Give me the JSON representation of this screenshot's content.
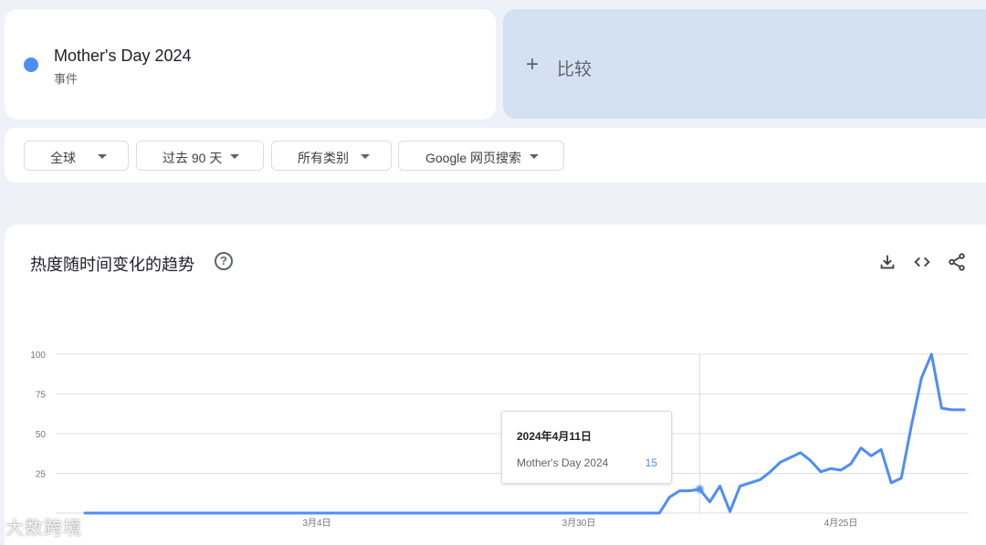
{
  "term": {
    "name": "Mother's Day 2024",
    "type": "事件",
    "color": "#4e8df5"
  },
  "compare": {
    "icon": "plus-icon",
    "plus": "+",
    "label": "比较"
  },
  "filters": [
    {
      "label": "全球"
    },
    {
      "label": "过去 90 天"
    },
    {
      "label": "所有类别"
    },
    {
      "label": "Google 网页搜索"
    }
  ],
  "chart_section": {
    "title": "热度随时间变化的趋势",
    "help": "?",
    "icons": [
      "download-icon",
      "embed-code-icon",
      "share-icon"
    ]
  },
  "tooltip": {
    "date": "2024年4月11日",
    "term": "Mother's Day 2024",
    "value": "15"
  },
  "watermark": "大数跨境",
  "chart_data": {
    "type": "line",
    "title": "",
    "xlabel": "",
    "ylabel": "",
    "ylim": [
      0,
      100
    ],
    "yticks": [
      25,
      50,
      75,
      100
    ],
    "grid": true,
    "xticks": [
      {
        "label": "3月4日",
        "date": "2024-03-04"
      },
      {
        "label": "3月30日",
        "date": "2024-03-30"
      },
      {
        "label": "4月25日",
        "date": "2024-04-25"
      }
    ],
    "highlight": {
      "date": "2024-04-11",
      "value": 15
    },
    "series": [
      {
        "name": "Mother's Day 2024",
        "color": "#4e8df5",
        "x": [
          "2024-02-10",
          "2024-02-15",
          "2024-02-20",
          "2024-02-25",
          "2024-03-01",
          "2024-03-06",
          "2024-03-11",
          "2024-03-16",
          "2024-03-21",
          "2024-03-26",
          "2024-03-31",
          "2024-04-05",
          "2024-04-07",
          "2024-04-08",
          "2024-04-09",
          "2024-04-10",
          "2024-04-11",
          "2024-04-12",
          "2024-04-13",
          "2024-04-14",
          "2024-04-15",
          "2024-04-16",
          "2024-04-17",
          "2024-04-18",
          "2024-04-19",
          "2024-04-20",
          "2024-04-21",
          "2024-04-22",
          "2024-04-23",
          "2024-04-24",
          "2024-04-25",
          "2024-04-26",
          "2024-04-27",
          "2024-04-28",
          "2024-04-29",
          "2024-04-30",
          "2024-05-01",
          "2024-05-02",
          "2024-05-03",
          "2024-05-04",
          "2024-05-05",
          "2024-05-06",
          "2024-05-07",
          "2024-05-08",
          "2024-05-09",
          "2024-05-10",
          "2024-05-11"
        ],
        "values": [
          0,
          0,
          0,
          0,
          0,
          0,
          0,
          0,
          0,
          0,
          0,
          0,
          0,
          10,
          14,
          14,
          15,
          7,
          17,
          1,
          17,
          19,
          21,
          26,
          32,
          35,
          38,
          33,
          26,
          28,
          27,
          31,
          41,
          36,
          40,
          19,
          22,
          55,
          85,
          100,
          66,
          65,
          65,
          65,
          65,
          65,
          65
        ]
      }
    ]
  }
}
